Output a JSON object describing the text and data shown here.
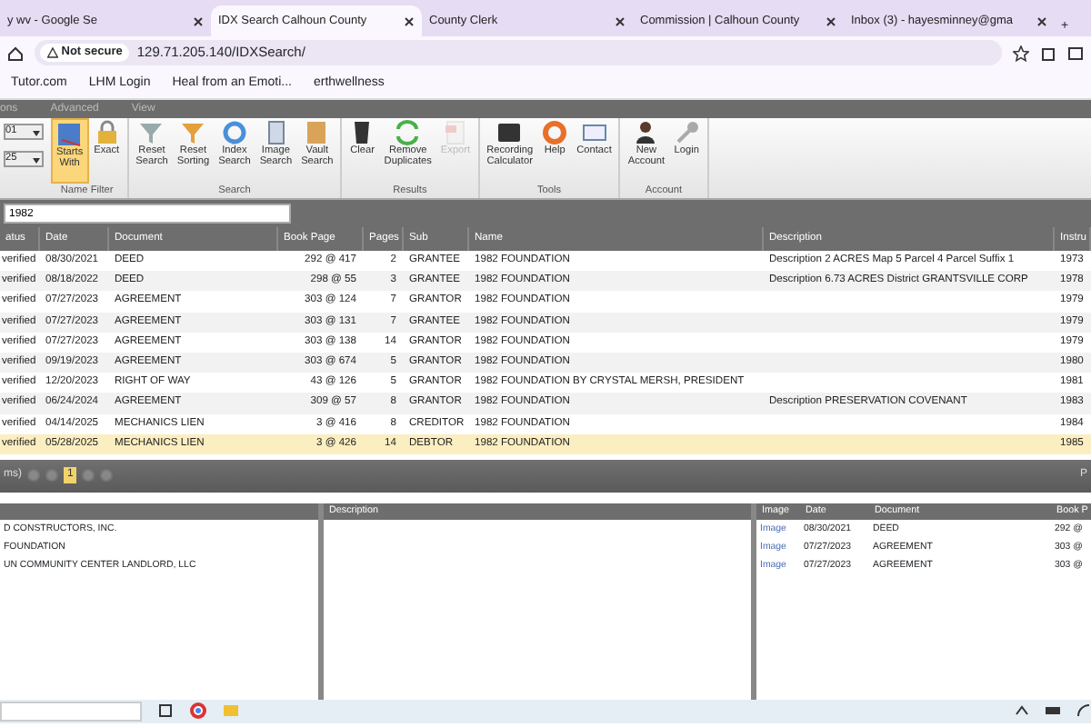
{
  "browser": {
    "tabs": [
      {
        "title": "y wv - Google Se",
        "selected": false
      },
      {
        "title": "IDX Search Calhoun County",
        "selected": true
      },
      {
        "title": "County Clerk",
        "selected": false
      },
      {
        "title": "Commission | Calhoun County",
        "selected": false
      },
      {
        "title": "Inbox (3) - hayesminney@gma",
        "selected": false
      }
    ],
    "new_tab": "+",
    "security": "Not secure",
    "url": "129.71.205.140/IDXSearch/",
    "bookmarks": [
      "Tutor.com",
      "LHM Login",
      "Heal from an Emoti...",
      "erthwellness"
    ]
  },
  "menu": [
    "ons",
    "Advanced",
    "View"
  ],
  "selectors": [
    "01",
    "25"
  ],
  "ribbon": [
    {
      "group": "Name Filter",
      "buttons": [
        {
          "label": "Starts With",
          "selected": true,
          "disabled": false
        },
        {
          "label": "Exact",
          "selected": false,
          "disabled": false
        }
      ]
    },
    {
      "group": "Search",
      "buttons": [
        {
          "label": "Reset Search",
          "selected": false,
          "disabled": false
        },
        {
          "label": "Reset Sorting",
          "selected": false,
          "disabled": false
        },
        {
          "label": "Index Search",
          "selected": false,
          "disabled": false
        },
        {
          "label": "Image Search",
          "selected": false,
          "disabled": false
        },
        {
          "label": "Vault Search",
          "selected": false,
          "disabled": false
        }
      ]
    },
    {
      "group": "Results",
      "buttons": [
        {
          "label": "Clear",
          "selected": false,
          "disabled": false
        },
        {
          "label": "Remove Duplicates",
          "selected": false,
          "disabled": false
        },
        {
          "label": "Export",
          "selected": false,
          "disabled": true
        }
      ]
    },
    {
      "group": "Tools",
      "buttons": [
        {
          "label": "Recording Calculator",
          "selected": false,
          "disabled": false
        },
        {
          "label": "Help",
          "selected": false,
          "disabled": false
        },
        {
          "label": "Contact",
          "selected": false,
          "disabled": false
        }
      ]
    },
    {
      "group": "Account",
      "buttons": [
        {
          "label": "New Account",
          "selected": false,
          "disabled": false
        },
        {
          "label": "Login",
          "selected": false,
          "disabled": false
        }
      ]
    }
  ],
  "search": {
    "value": "1982"
  },
  "table": {
    "columns": [
      "atus",
      "Date",
      "Document",
      "Book Page",
      "Pages",
      "Sub",
      "Name",
      "Description",
      "Instru"
    ],
    "rows": [
      {
        "cells": [
          "verified",
          "08/30/2021",
          "DEED",
          "292 @ 417",
          "2",
          "GRANTEE",
          "1982 FOUNDATION",
          "Description 2 ACRES Map 5 Parcel 4 Parcel Suffix 1",
          "1973"
        ],
        "selected": false
      },
      {
        "cells": [
          "verified",
          "08/18/2022",
          "DEED",
          "298 @ 55",
          "3",
          "GRANTEE",
          "1982 FOUNDATION",
          "Description 6.73 ACRES District GRANTSVILLE CORP",
          "1978"
        ],
        "selected": false
      },
      {
        "cells": [
          "verified",
          "07/27/2023",
          "AGREEMENT",
          "303 @ 124",
          "7",
          "GRANTOR",
          "1982 FOUNDATION",
          "",
          "1979"
        ],
        "selected": false
      },
      {
        "cells": [
          "verified",
          "07/27/2023",
          "AGREEMENT",
          "303 @ 131",
          "7",
          "GRANTEE",
          "1982 FOUNDATION",
          "",
          "1979"
        ],
        "selected": false
      },
      {
        "cells": [
          "verified",
          "07/27/2023",
          "AGREEMENT",
          "303 @ 138",
          "14",
          "GRANTOR",
          "1982 FOUNDATION",
          "",
          "1979"
        ],
        "selected": false
      },
      {
        "cells": [
          "verified",
          "09/19/2023",
          "AGREEMENT",
          "303 @ 674",
          "5",
          "GRANTOR",
          "1982 FOUNDATION",
          "",
          "1980"
        ],
        "selected": false
      },
      {
        "cells": [
          "verified",
          "12/20/2023",
          "RIGHT OF WAY",
          "43 @ 126",
          "5",
          "GRANTOR",
          "1982 FOUNDATION BY CRYSTAL MERSH, PRESIDENT",
          "",
          "1981"
        ],
        "selected": false
      },
      {
        "cells": [
          "verified",
          "06/24/2024",
          "AGREEMENT",
          "309 @ 57",
          "8",
          "GRANTOR",
          "1982 FOUNDATION",
          "Description PRESERVATION COVENANT",
          "1983"
        ],
        "selected": false
      },
      {
        "cells": [
          "verified",
          "04/14/2025",
          "MECHANICS LIEN",
          "3 @ 416",
          "8",
          "CREDITOR",
          "1982 FOUNDATION",
          "",
          "1984"
        ],
        "selected": false
      },
      {
        "cells": [
          "verified",
          "05/28/2025",
          "MECHANICS LIEN",
          "3 @ 426",
          "14",
          "DEBTOR",
          "1982 FOUNDATION",
          "",
          "1985"
        ],
        "selected": true
      }
    ]
  },
  "pager": {
    "summary": "ms)",
    "pages": [
      {
        "label": "1",
        "selected": true
      }
    ],
    "right_text": "P"
  },
  "names_panel": {
    "rows": [
      "D CONSTRUCTORS, INC.",
      "FOUNDATION",
      "UN COMMUNITY CENTER LANDLORD, LLC"
    ]
  },
  "description_panel": {
    "header": "Description"
  },
  "related_panel": {
    "columns": [
      "Image",
      "Date",
      "Document",
      "Book P"
    ],
    "rows": [
      [
        "Image",
        "08/30/2021",
        "DEED",
        "292 @"
      ],
      [
        "Image",
        "07/27/2023",
        "AGREEMENT",
        "303 @"
      ],
      [
        "Image",
        "07/27/2023",
        "AGREEMENT",
        "303 @"
      ]
    ]
  }
}
